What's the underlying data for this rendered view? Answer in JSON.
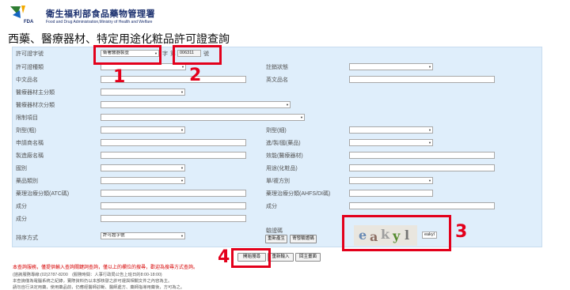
{
  "header": {
    "site_name_cn": "衛生福利部食品藥物管理署",
    "site_name_en": "Food and Drug Administration,Ministry of Health and Welfare",
    "logo_text": "FDA"
  },
  "page_title": "西藥、醫療器材、特定用途化粧品許可證查詢",
  "form": {
    "license_no": {
      "label": "許可證字號",
      "select_value": "衛署醫器製壹",
      "word_label": "字",
      "word_label2": "第",
      "number_value": "006311",
      "suffix": "號"
    },
    "license_type": {
      "label": "許可證種類"
    },
    "cancel_status": {
      "label": "註銷狀態"
    },
    "chinese_name": {
      "label": "中文品名"
    },
    "english_name": {
      "label": "英文品名"
    },
    "device_main_class": {
      "label": "醫療器材主分類"
    },
    "device_sub_class": {
      "label": "醫療器材次分類"
    },
    "restriction": {
      "label": "限制項目"
    },
    "dosage_form_major": {
      "label": "劑型(粗)"
    },
    "dosage_form_minor": {
      "label": "劑型(細)"
    },
    "applicant_name": {
      "label": "申請商名稱"
    },
    "import_export": {
      "label": "進/製/國(藥品)"
    },
    "manufacturer_name": {
      "label": "製造廠名稱"
    },
    "efficacy": {
      "label": "效能(醫療器材)"
    },
    "country": {
      "label": "國別"
    },
    "usage": {
      "label": "用途(化粧品)"
    },
    "drug_category": {
      "label": "藥品類別"
    },
    "single_compound": {
      "label": "單/複方別"
    },
    "atc_code": {
      "label": "藥理治療分類(ATC碼)"
    },
    "ahfs_code": {
      "label": "藥理治療分類(AHFS/DI碼)"
    },
    "ingredient_1": {
      "label": "成分"
    },
    "ingredient_2": {
      "label": "成分"
    },
    "ingredient_3": {
      "label": "成分"
    },
    "sort": {
      "label": "排序方式",
      "select_value": "許可證字號"
    },
    "captcha": {
      "label": "驗證碼",
      "refresh_label": "重新產生",
      "audio_label": "寄發驗證碼",
      "input_value": "eakyl",
      "image_text": [
        "e",
        "a",
        "k",
        "y",
        "l"
      ]
    }
  },
  "actions": {
    "search_label": "開始搜尋",
    "reset_label": "重新輸入",
    "back_label": "回主畫面"
  },
  "annotations": [
    "1",
    "2",
    "3",
    "4"
  ],
  "notes": {
    "line1": "本查詢服務，僅提供輸入查詢關鍵詞查詢，僅以上的欄位的搜尋，歡迎為搜尋方式查詢。",
    "line2": "(諮詢服務專線:(02)2787-8200　(服務時間：人事行政局公告上班日的8:00-18:00)",
    "line3": "本查詢僅為電腦系統之紀錄，實際資料仍以本部核發之許可證與相關文件之內容為主。",
    "line4": "請勿自行決定用藥，使用藥品前，仍應經醫師診斷、醫師處方、藥師指導用藥後，方可為之。"
  },
  "colors": {
    "accent_red": "#e3001b",
    "form_bg": "#dfeefb",
    "title_blue": "#1a2f6e"
  }
}
